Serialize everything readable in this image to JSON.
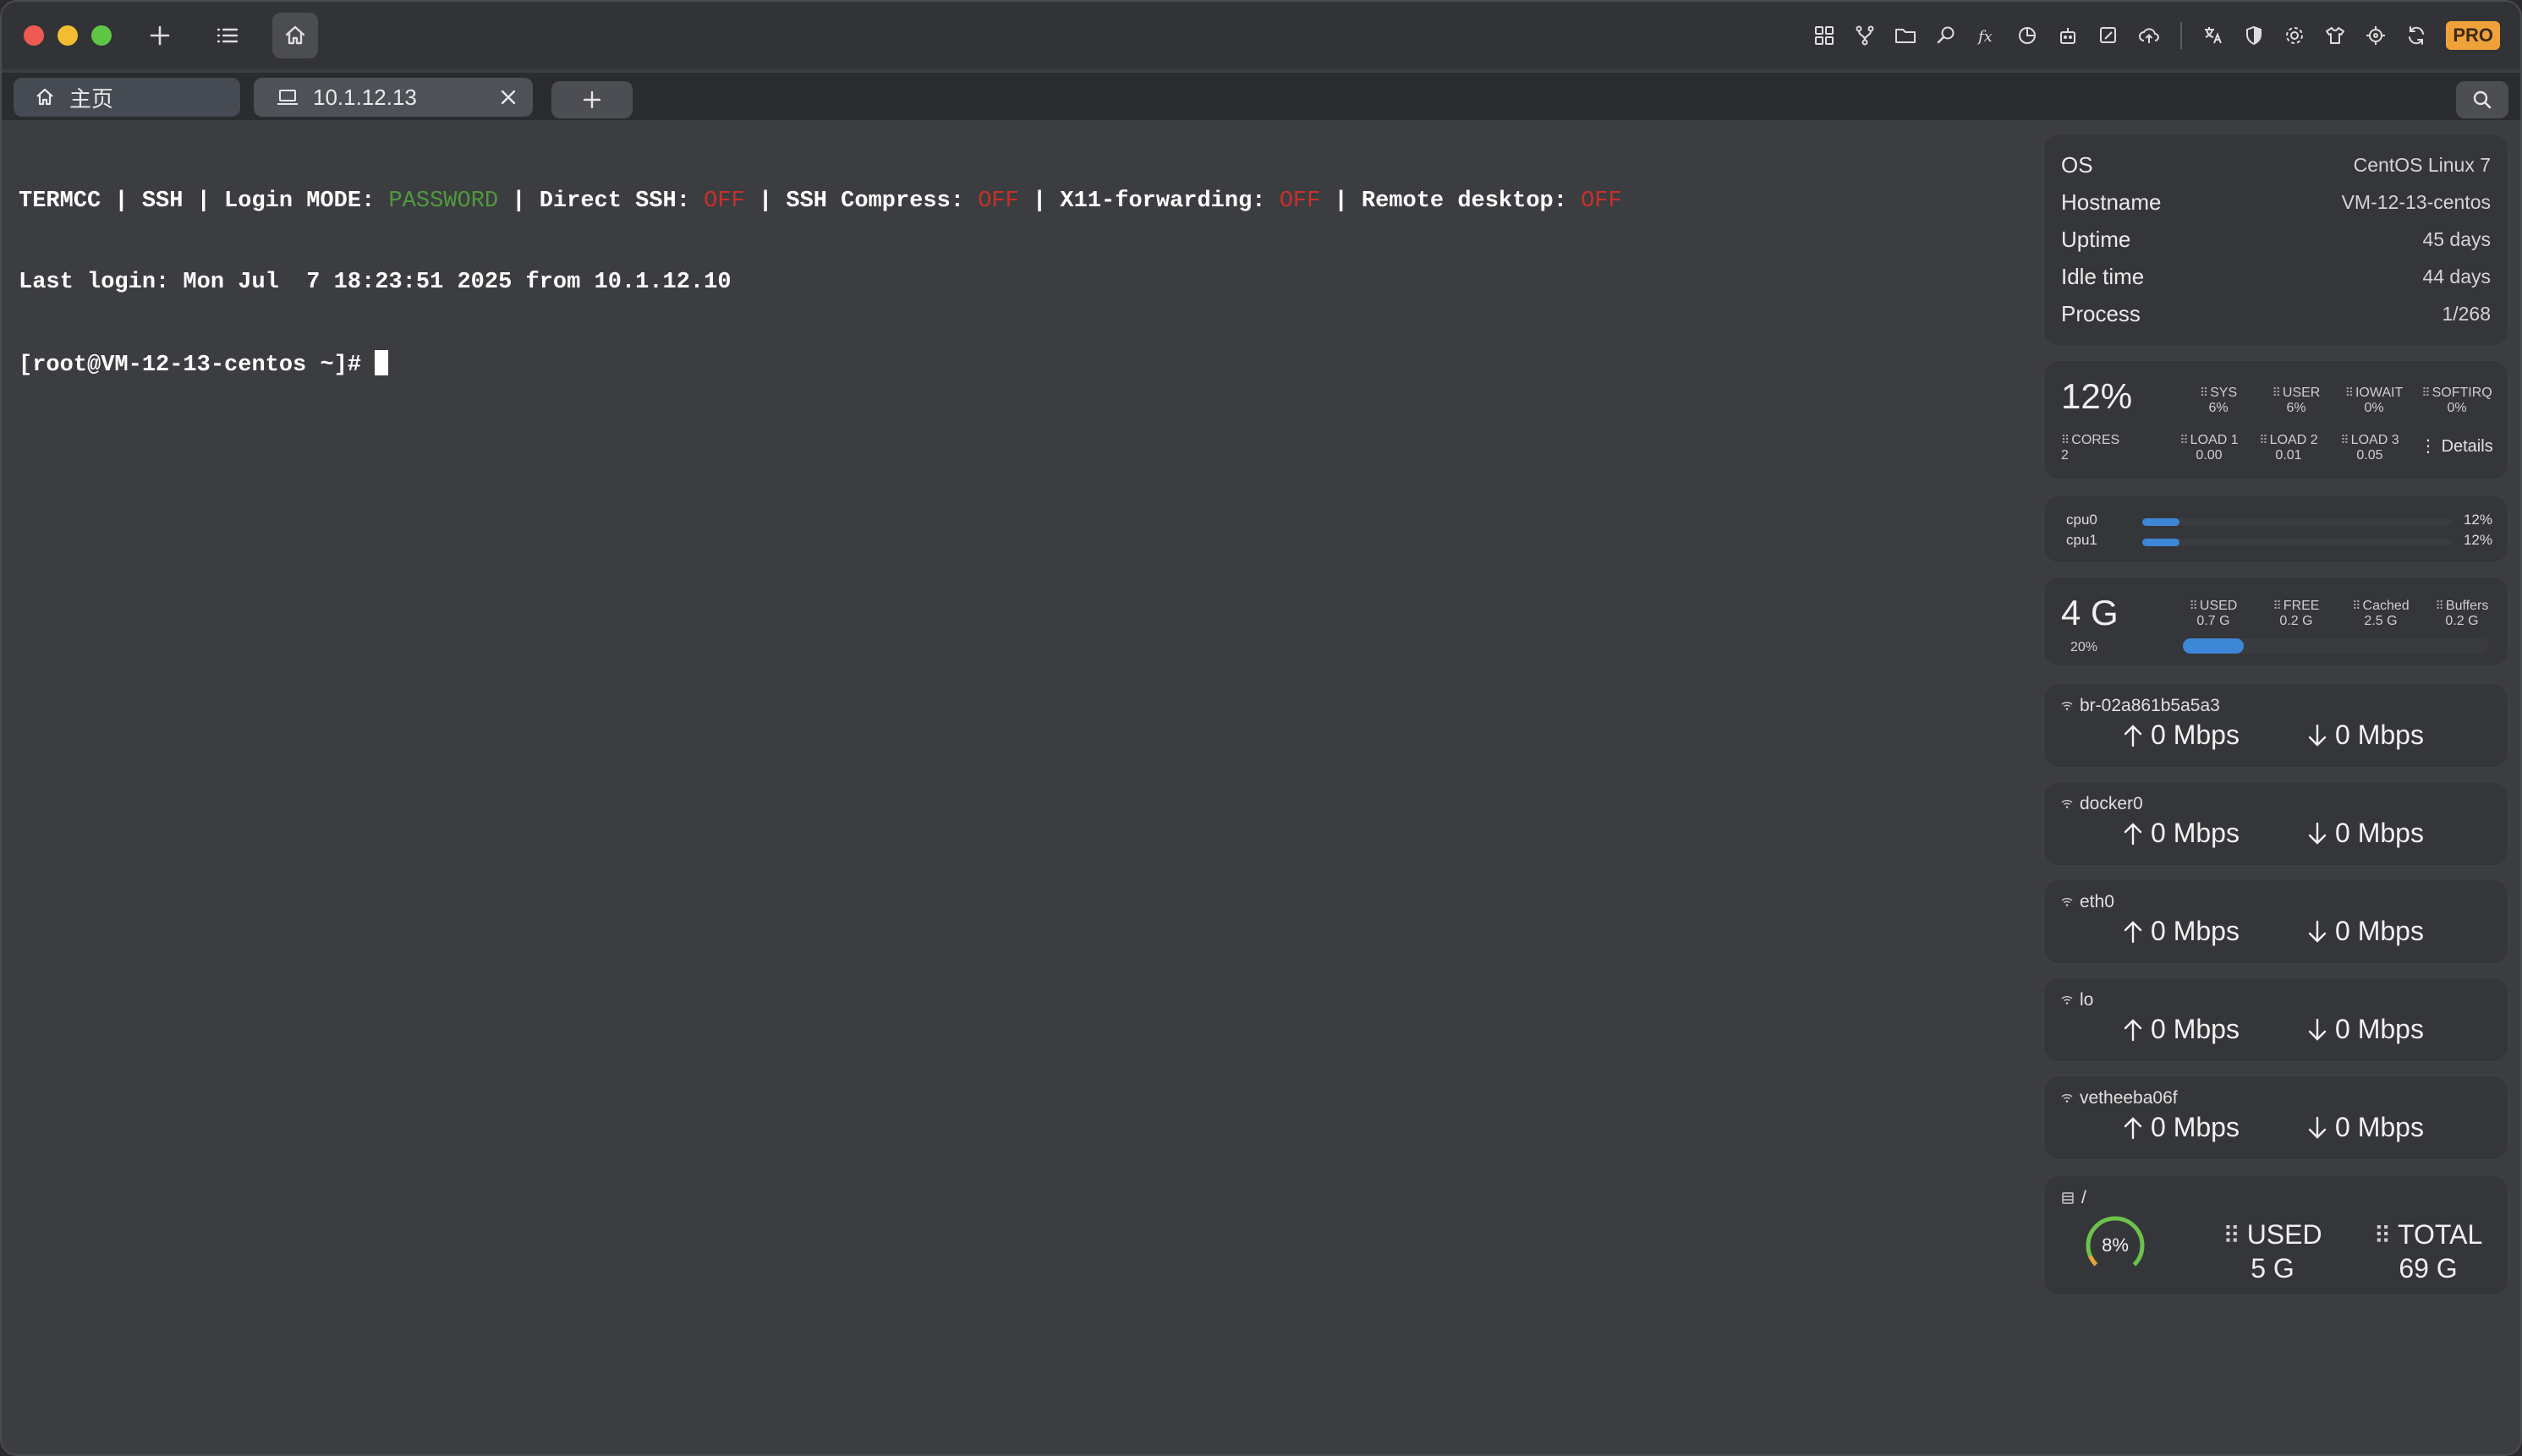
{
  "titlebar": {
    "pro_label": "PRO"
  },
  "tabs": {
    "home_label": "主页",
    "host_label": "10.1.12.13"
  },
  "terminal": {
    "line1": {
      "prefix": "TERMCC | SSH | Login MODE: ",
      "mode": "PASSWORD",
      "ds_label": " | Direct SSH: ",
      "ds_value": "OFF",
      "comp_label": " | SSH Compress: ",
      "comp_value": "OFF",
      "x11_label": " | X11-forwarding: ",
      "x11_value": "OFF",
      "rd_label": " | Remote desktop: ",
      "rd_value": "OFF"
    },
    "line2": "Last login: Mon Jul  7 18:23:51 2025 from 10.1.12.10",
    "prompt": "[root@VM-12-13-centos ~]# "
  },
  "system_info": {
    "rows": [
      {
        "key": "OS",
        "value": "CentOS Linux 7"
      },
      {
        "key": "Hostname",
        "value": "VM-12-13-centos"
      },
      {
        "key": "Uptime",
        "value": "45 days"
      },
      {
        "key": "Idle time",
        "value": "44 days"
      },
      {
        "key": "Process",
        "value": "1/268"
      }
    ]
  },
  "cpu": {
    "total": "12%",
    "sys_label": "SYS",
    "sys_value": "6%",
    "user_label": "USER",
    "user_value": "6%",
    "iowait_label": "IOWAIT",
    "iowait_value": "0%",
    "softirq_label": "SOFTIRQ",
    "softirq_value": "0%",
    "cores_label": "CORES",
    "cores_value": "2",
    "load1_label": "LOAD 1",
    "load1_value": "0.00",
    "load2_label": "LOAD 2",
    "load2_value": "0.01",
    "load3_label": "LOAD 3",
    "load3_value": "0.05",
    "details_label": "Details",
    "cores": [
      {
        "name": "cpu0",
        "percent_label": "12%",
        "fraction": 0.12
      },
      {
        "name": "cpu1",
        "percent_label": "12%",
        "fraction": 0.12
      }
    ]
  },
  "memory": {
    "total": "4 G",
    "percent_label": "20%",
    "fraction": 0.2,
    "used_label": "USED",
    "used_value": "0.7 G",
    "free_label": "FREE",
    "free_value": "0.2 G",
    "cached_label": "Cached",
    "cached_value": "2.5 G",
    "buffers_label": "Buffers",
    "buffers_value": "0.2 G"
  },
  "network": [
    {
      "name": "br-02a861b5a5a3",
      "up": "0 Mbps",
      "down": "0 Mbps"
    },
    {
      "name": "docker0",
      "up": "0 Mbps",
      "down": "0 Mbps"
    },
    {
      "name": "eth0",
      "up": "0 Mbps",
      "down": "0 Mbps"
    },
    {
      "name": "lo",
      "up": "0 Mbps",
      "down": "0 Mbps"
    },
    {
      "name": "vetheeba06f",
      "up": "0 Mbps",
      "down": "0 Mbps"
    }
  ],
  "disk": {
    "mount": "/",
    "percent_label": "8%",
    "fraction": 0.08,
    "used_label": "USED",
    "used_value": "5 G",
    "total_label": "TOTAL",
    "total_value": "69 G"
  },
  "colors": {
    "accent_blue": "#3e86d6",
    "status_green": "#4f9a3f",
    "status_red": "#c8302b",
    "pro_orange": "#f0a23a",
    "gauge_green": "#6cc24a",
    "gauge_orange": "#e8a33a"
  }
}
